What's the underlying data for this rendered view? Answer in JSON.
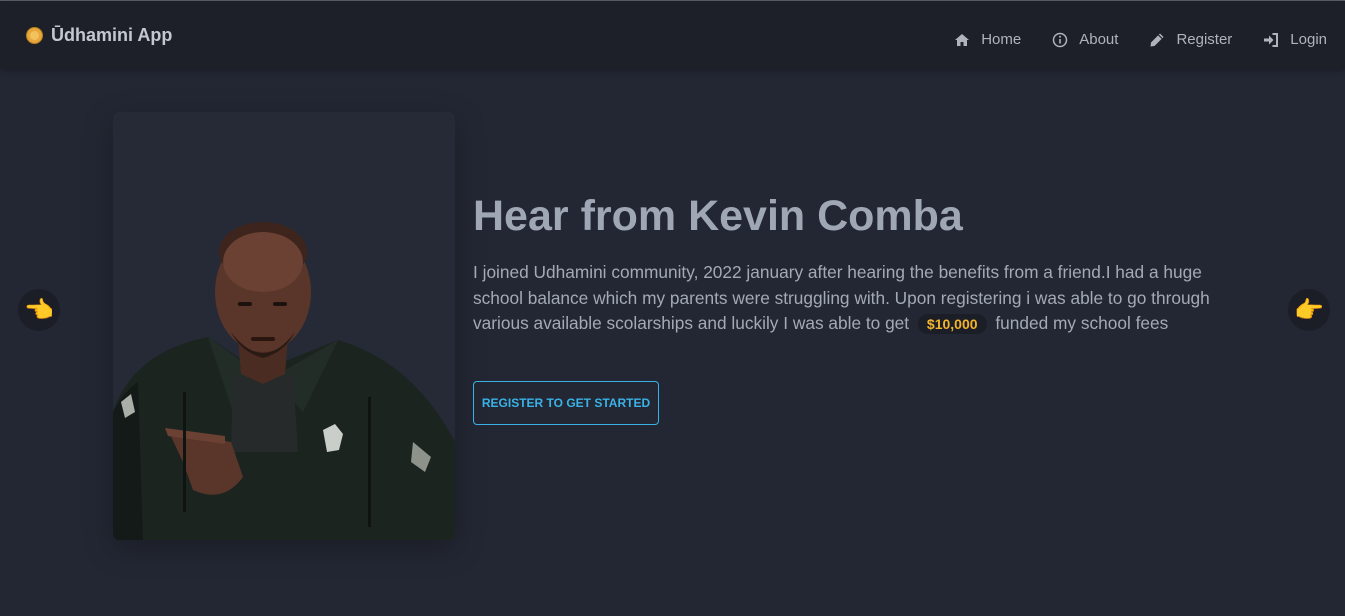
{
  "brand": {
    "name": "Ūdhamini App",
    "icon": "coin-icon"
  },
  "nav": {
    "items": [
      {
        "label": "Home",
        "icon": "home-icon"
      },
      {
        "label": "About",
        "icon": "info-icon"
      },
      {
        "label": "Register",
        "icon": "pencil-icon"
      },
      {
        "label": "Login",
        "icon": "sign-in-icon"
      }
    ]
  },
  "testimonial": {
    "title": "Hear from Kevin Comba",
    "text_before": "I joined Udhamini community, 2022 january after hearing the benefits from a friend.I had a huge school balance which my parents were struggling with. Upon registering i was able to go through various available scolarships and luckily I was able to get",
    "amount": "$10,000",
    "text_after": "funded my school fees",
    "cta_label": "REGISTER TO GET STARTED"
  },
  "carousel": {
    "prev_glyph": "👈",
    "next_glyph": "👉"
  },
  "colors": {
    "background": "#232733",
    "navbar": "#1d2029",
    "accent": "#39b3e7",
    "amount": "#f3b32a"
  }
}
